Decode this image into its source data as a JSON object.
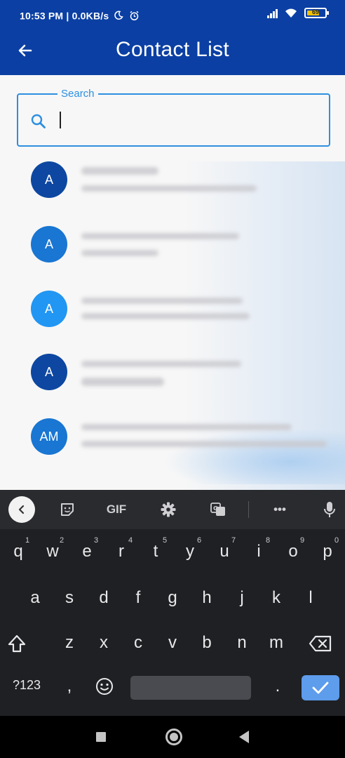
{
  "status_bar": {
    "time_speed": "10:53 PM | 0.0KB/s",
    "battery": "69"
  },
  "app_bar": {
    "title": "Contact List",
    "back_icon": "arrow-left-icon"
  },
  "search": {
    "label": "Search",
    "value": "",
    "placeholder": ""
  },
  "contacts": [
    {
      "initials": "A",
      "color": "#0d47a1"
    },
    {
      "initials": "A",
      "color": "#1976d2"
    },
    {
      "initials": "A",
      "color": "#2196f3"
    },
    {
      "initials": "A",
      "color": "#0d47a1"
    },
    {
      "initials": "AM",
      "color": "#1976d2"
    }
  ],
  "keyboard": {
    "toolbar": {
      "gif_label": "GIF",
      "more_label": "•••"
    },
    "row1": [
      "q",
      "w",
      "e",
      "r",
      "t",
      "y",
      "u",
      "i",
      "o",
      "p"
    ],
    "row1_hints": [
      "1",
      "2",
      "3",
      "4",
      "5",
      "6",
      "7",
      "8",
      "9",
      "0"
    ],
    "row2": [
      "a",
      "s",
      "d",
      "f",
      "g",
      "h",
      "j",
      "k",
      "l"
    ],
    "row3": [
      "z",
      "x",
      "c",
      "v",
      "b",
      "n",
      "m"
    ],
    "symbols_label": "?123",
    "comma_label": ",",
    "period_label": "."
  }
}
